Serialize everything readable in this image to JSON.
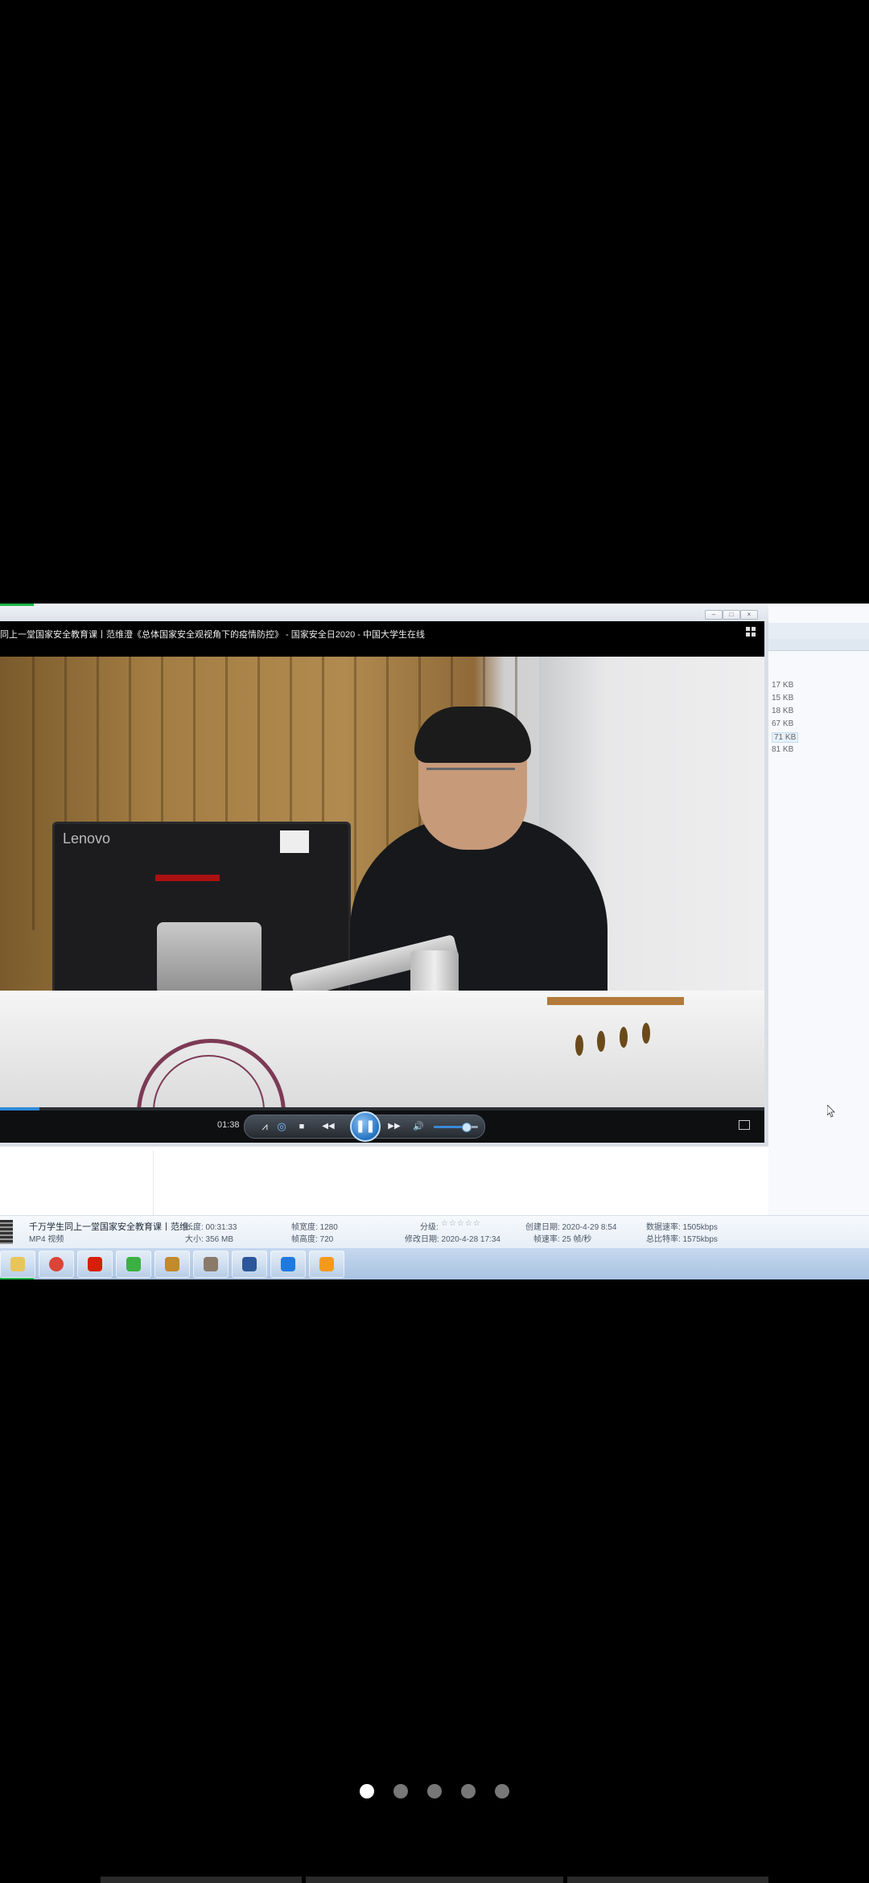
{
  "player": {
    "title": "同上一堂国家安全教育课丨范维澄《总体国家安全观视角下的疫情防控》 - 国家安全日2020 - 中国大学生在线",
    "monitor_brand": "Lenovo",
    "current_time": "01:38",
    "progress_fraction": 0.052,
    "volume_fraction": 0.72,
    "controls": {
      "shrink": "⩘",
      "loop": "◎",
      "stop": "■",
      "rewind": "◀◀",
      "pause": "❚❚",
      "forward": "▶▶",
      "volume": "🔊"
    }
  },
  "explorer": {
    "sizes": [
      "17 KB",
      "15 KB",
      "18 KB",
      "67 KB",
      "71 KB",
      "81 KB"
    ]
  },
  "details": {
    "file_name": "千万学生同上一堂国家安全教育课丨范维...",
    "file_type": "MP4 视频",
    "length": "长度: 00:31:33",
    "size": "大小: 356 MB",
    "frame_width": "帧宽度: 1280",
    "frame_height": "帧高度: 720",
    "rating_label": "分级:",
    "rating_stars": "☆☆☆☆☆",
    "modified": "修改日期: 2020-4-28 17:34",
    "created": "创建日期: 2020-4-29 8:54",
    "frame_rate": "帧速率: 25 帧/秒",
    "data_rate": "数据速率: 1505kbps",
    "total_bitrate": "总比特率: 1575kbps"
  },
  "taskbar": {
    "icons": [
      "explorer-icon",
      "chrome-icon",
      "netease-music-icon",
      "refresh-app-icon",
      "game-icon",
      "wallet-icon",
      "word-icon",
      "tencent-meeting-icon",
      "media-player-icon"
    ],
    "colors": [
      "#e7c55a",
      "#db4437",
      "#d81e06",
      "#3cb043",
      "#c28a2b",
      "#8a7a6a",
      "#2b579a",
      "#1f7ae0",
      "#f39a1e"
    ]
  },
  "pager": {
    "count": 5,
    "active_index": 0
  }
}
